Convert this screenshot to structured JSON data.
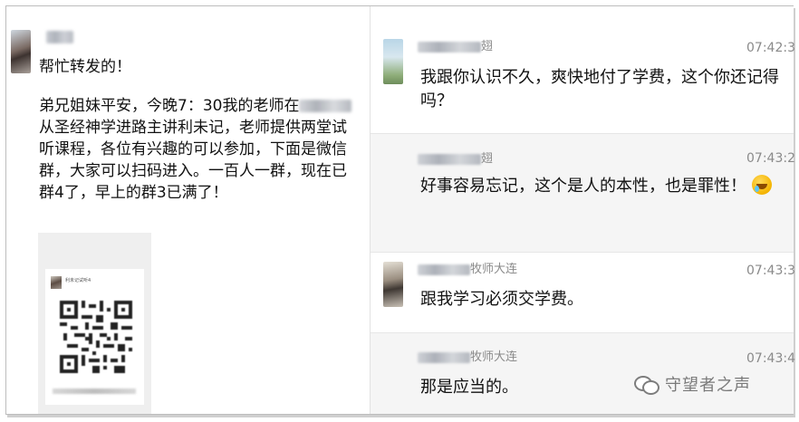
{
  "left_panel": {
    "sender_name": "",
    "message_1": "帮忙转发的！",
    "message_2_before": "弟兄姐妹平安，今晚7：30我的老师在",
    "message_2_after": "从圣经神学进路主讲利未记，老师提供两堂试听课程，各位有兴趣的可以参加，下面是微信群，大家可以扫码进入。一百人一群，现在已群4了，早上的群3已满了！",
    "qr_card": {
      "group_name": "利未记试听4"
    }
  },
  "right_panel": {
    "messages": [
      {
        "name_suffix": "翅",
        "time": "07:42:3",
        "text": "我跟你认识不久，爽快地付了学费，这个你还记得吗？",
        "has_emoji": false
      },
      {
        "name_suffix": "翅",
        "time": "07:43:2",
        "text": "好事容易忘记，这个是人的本性，也是罪性！",
        "has_emoji": true,
        "emoji": "facepalm-laugh"
      },
      {
        "name_suffix": "牧师大连",
        "time": "07:43:3",
        "text": "跟我学习必须交学费。",
        "has_emoji": false
      },
      {
        "name_suffix": "牧师大连",
        "time": "07:43:4",
        "text": "那是应当的。",
        "has_emoji": false
      }
    ]
  },
  "watermark": {
    "text": "守望者之声",
    "icon": "wechat-icon"
  }
}
